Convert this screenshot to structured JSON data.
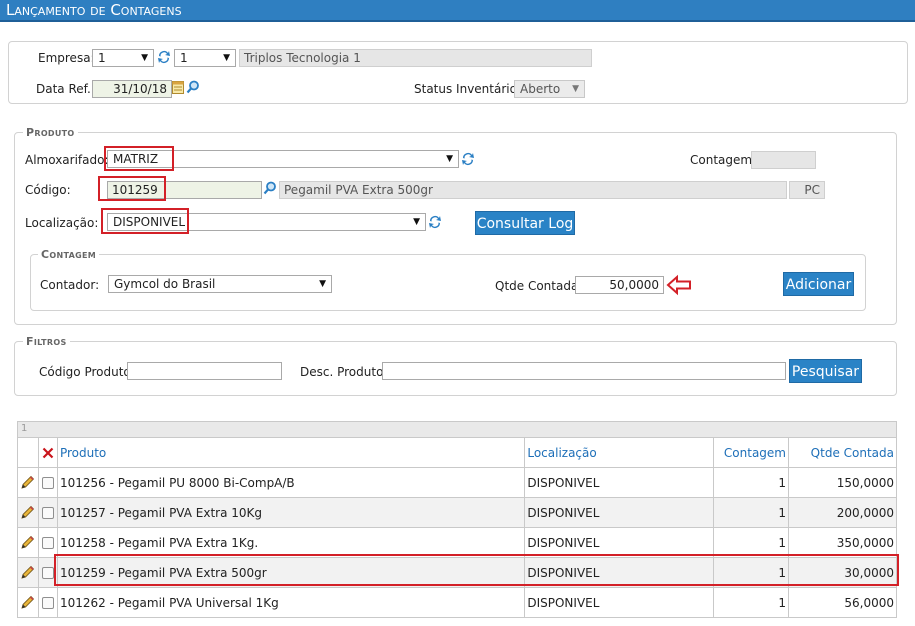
{
  "window": {
    "title": "Lançamento de Contagens"
  },
  "header": {
    "empresa_label": "Empresa:",
    "empresa_value": "1",
    "filial_value": "1",
    "empresa_name": "Triplos Tecnologia 1",
    "dataref_label": "Data Ref.:",
    "dataref_value": "31/10/18",
    "status_label": "Status Inventário:",
    "status_value": "Aberto"
  },
  "produto": {
    "legend": "Produto",
    "almox_label": "Almoxarifado:",
    "almox_value": "MATRIZ",
    "contagem_label": "Contagem:",
    "contagem_value": "",
    "codigo_label": "Código:",
    "codigo_value": "101259",
    "descricao_value": "Pegamil PVA Extra 500gr",
    "unidade_value": "PC",
    "local_label": "Localização:",
    "local_value": "DISPONIVEL",
    "consultar_log_label": "Consultar Log"
  },
  "contagem": {
    "legend": "Contagem",
    "contador_label": "Contador:",
    "contador_value": "Gymcol do Brasil",
    "qtde_label": "Qtde Contada:",
    "qtde_value": "50,0000",
    "adicionar_label": "Adicionar"
  },
  "filtros": {
    "legend": "Filtros",
    "codigo_label": "Código Produto:",
    "codigo_value": "",
    "desc_label": "Desc. Produto:",
    "desc_value": "",
    "pesquisar_label": "Pesquisar"
  },
  "grid": {
    "page_indicator": "1",
    "columns": [
      "Produto",
      "Localização",
      "Contagem",
      "Qtde Contada"
    ],
    "rows": [
      {
        "produto": "101256 - Pegamil PU 8000 Bi-CompA/B",
        "local": "DISPONIVEL",
        "contagem": "1",
        "qtde": "150,0000"
      },
      {
        "produto": "101257 - Pegamil PVA Extra 10Kg",
        "local": "DISPONIVEL",
        "contagem": "1",
        "qtde": "200,0000"
      },
      {
        "produto": "101258 - Pegamil PVA Extra 1Kg.",
        "local": "DISPONIVEL",
        "contagem": "1",
        "qtde": "350,0000"
      },
      {
        "produto": "101259 - Pegamil PVA Extra 500gr",
        "local": "DISPONIVEL",
        "contagem": "1",
        "qtde": "30,0000"
      },
      {
        "produto": "101262 - Pegamil PVA Universal 1Kg",
        "local": "DISPONIVEL",
        "contagem": "1",
        "qtde": "56,0000"
      }
    ]
  },
  "icons": {
    "refresh": "refresh-icon",
    "calendar": "calendar-icon",
    "search": "search-icon",
    "edit": "pencil-icon",
    "delete": "delete-x-icon",
    "arrow": "left-arrow-annotation-icon"
  },
  "colors": {
    "accent": "#2f7fc1",
    "button": "#2a83c6",
    "highlight": "#d32027"
  }
}
